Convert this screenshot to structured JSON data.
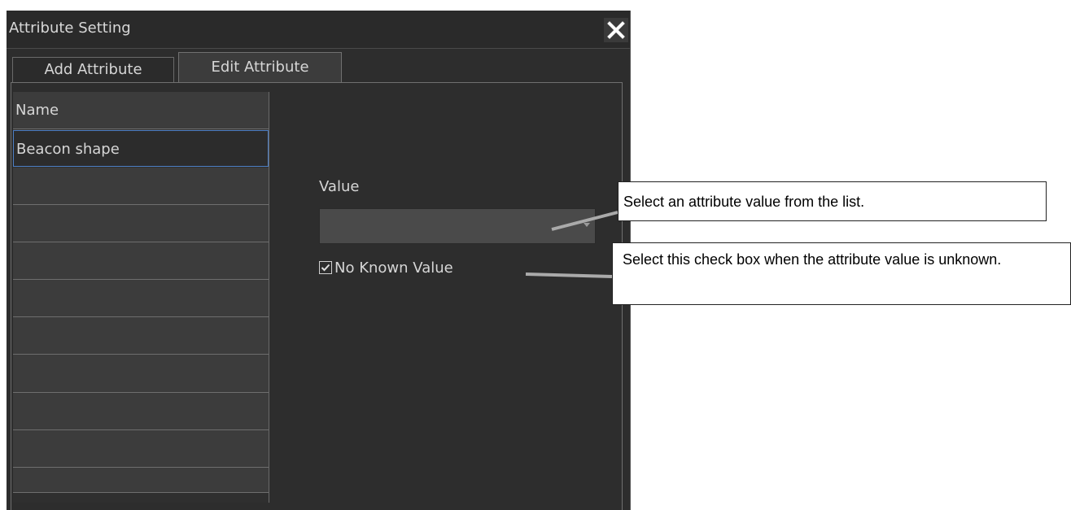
{
  "dialog": {
    "title": "Attribute Setting",
    "close_icon": "close-icon",
    "tabs": [
      {
        "label": "Add Attribute",
        "active": false
      },
      {
        "label": "Edit Attribute",
        "active": true
      }
    ],
    "name_list": {
      "header": "Name",
      "items": [
        "Beacon shape",
        "",
        "",
        "",
        "",
        "",
        "",
        "",
        "",
        ""
      ],
      "selected_index": 0
    },
    "value": {
      "label": "Value",
      "selected": ""
    },
    "no_known_value": {
      "label": "No Known Value",
      "checked": true
    }
  },
  "annotations": [
    {
      "text": "Select an attribute value from the list."
    },
    {
      "text": "Select this check box when the attribute value is unknown."
    }
  ],
  "colors": {
    "dialog_bg": "#2d2d2d",
    "selection_border": "#4d7fc4",
    "text": "#d6d6d6"
  }
}
